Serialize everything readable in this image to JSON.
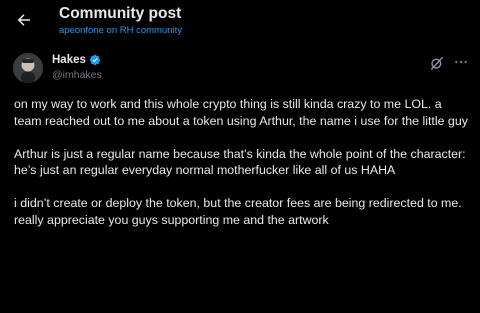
{
  "header": {
    "title": "Community post",
    "subtitle": "apeonfone on RH community"
  },
  "author": {
    "name": "Hakes",
    "handle": "@imhakes",
    "verified": true
  },
  "icons": {
    "back": "arrow-left-icon",
    "verified": "verified-badge-icon",
    "grok": "grok-icon",
    "more": "more-horizontal-icon"
  },
  "colors": {
    "background": "#000000",
    "text": "#e7e9ea",
    "secondary": "#71767b",
    "accent": "#1d9bf0"
  },
  "post": {
    "paragraphs": [
      "on my way to work and this whole crypto thing is still kinda crazy to me LOL. a team reached out to me about a token using Arthur, the name i use for the little guy",
      "Arthur is just a regular name because that’s kinda the whole point of the character: he’s just an regular everyday normal motherfucker like all of us HAHA",
      "i didn’t create or deploy the token, but the creator fees are being redirected to me. really appreciate you guys supporting me and the artwork"
    ]
  }
}
